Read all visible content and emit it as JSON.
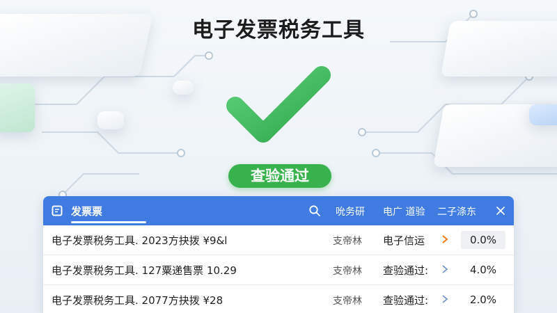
{
  "page": {
    "title": "电子发票税务工具"
  },
  "status_badge": {
    "label": "查验通过",
    "color": "#37b24d"
  },
  "panel": {
    "header": {
      "title": "发票票",
      "columns": [
        "吮务研",
        "电广 道验",
        "二子涤东"
      ],
      "accent": "#3f7be0"
    },
    "rows": [
      {
        "description": "电子发票税务工具. 2023方抉拨 ¥9&l",
        "vendor": "支帝林",
        "status": "电子信运",
        "chevron": "orange",
        "percent": "0.0%"
      },
      {
        "description": "电子发票税务工具. 127粟递售票 10.29",
        "vendor": "支帝林",
        "status": "查验通过:",
        "chevron": "blue",
        "percent": "4.0%"
      },
      {
        "description": "电子发票税务工具. 2077方抉拨 ¥28",
        "vendor": "支帝林",
        "status": "查验通过:",
        "chevron": "blue",
        "percent": "2.0%"
      }
    ]
  },
  "colors": {
    "chevron_orange": "#f07b1a",
    "chevron_blue": "#6b8fc9"
  }
}
